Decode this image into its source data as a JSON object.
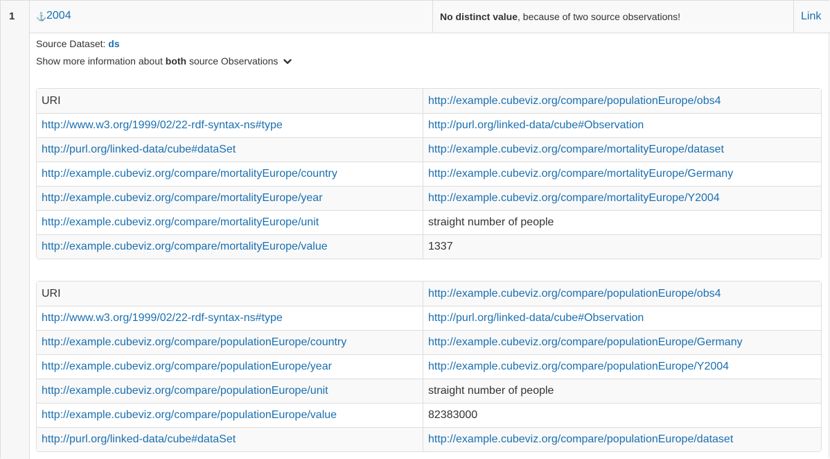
{
  "row": {
    "index": "1",
    "year": "2004",
    "message_bold": "No distinct value",
    "message_rest": ", because of two source observations!",
    "link": "Link"
  },
  "source": {
    "label": "Source Dataset: ",
    "dataset": "ds"
  },
  "more": {
    "prefix": "Show more information about ",
    "bold": "both",
    "suffix": " source Observations"
  },
  "observations": [
    {
      "rows": [
        {
          "key": "URI",
          "key_link": false,
          "value": "http://example.cubeviz.org/compare/populationEurope/obs4",
          "value_link": true
        },
        {
          "key": "http://www.w3.org/1999/02/22-rdf-syntax-ns#type",
          "key_link": true,
          "value": "http://purl.org/linked-data/cube#Observation",
          "value_link": true
        },
        {
          "key": "http://purl.org/linked-data/cube#dataSet",
          "key_link": true,
          "value": "http://example.cubeviz.org/compare/mortalityEurope/dataset",
          "value_link": true
        },
        {
          "key": "http://example.cubeviz.org/compare/mortalityEurope/country",
          "key_link": true,
          "value": "http://example.cubeviz.org/compare/mortalityEurope/Germany",
          "value_link": true
        },
        {
          "key": "http://example.cubeviz.org/compare/mortalityEurope/year",
          "key_link": true,
          "value": "http://example.cubeviz.org/compare/mortalityEurope/Y2004",
          "value_link": true
        },
        {
          "key": "http://example.cubeviz.org/compare/mortalityEurope/unit",
          "key_link": true,
          "value": "straight number of people",
          "value_link": false
        },
        {
          "key": "http://example.cubeviz.org/compare/mortalityEurope/value",
          "key_link": true,
          "value": "1337",
          "value_link": false
        }
      ]
    },
    {
      "rows": [
        {
          "key": "URI",
          "key_link": false,
          "value": "http://example.cubeviz.org/compare/populationEurope/obs4",
          "value_link": true
        },
        {
          "key": "http://www.w3.org/1999/02/22-rdf-syntax-ns#type",
          "key_link": true,
          "value": "http://purl.org/linked-data/cube#Observation",
          "value_link": true
        },
        {
          "key": "http://example.cubeviz.org/compare/populationEurope/country",
          "key_link": true,
          "value": "http://example.cubeviz.org/compare/populationEurope/Germany",
          "value_link": true
        },
        {
          "key": "http://example.cubeviz.org/compare/populationEurope/year",
          "key_link": true,
          "value": "http://example.cubeviz.org/compare/populationEurope/Y2004",
          "value_link": true
        },
        {
          "key": "http://example.cubeviz.org/compare/populationEurope/unit",
          "key_link": true,
          "value": "straight number of people",
          "value_link": false
        },
        {
          "key": "http://example.cubeviz.org/compare/populationEurope/value",
          "key_link": true,
          "value": "82383000",
          "value_link": false
        },
        {
          "key": "http://purl.org/linked-data/cube#dataSet",
          "key_link": true,
          "value": "http://example.cubeviz.org/compare/populationEurope/dataset",
          "value_link": true
        }
      ]
    }
  ],
  "colors": {
    "link": "#1a6fb0",
    "border": "#dddddd",
    "stripe": "#f9f9f9"
  },
  "icons": {
    "anchor": "anchor-icon",
    "chevron": "chevron-down-icon"
  }
}
